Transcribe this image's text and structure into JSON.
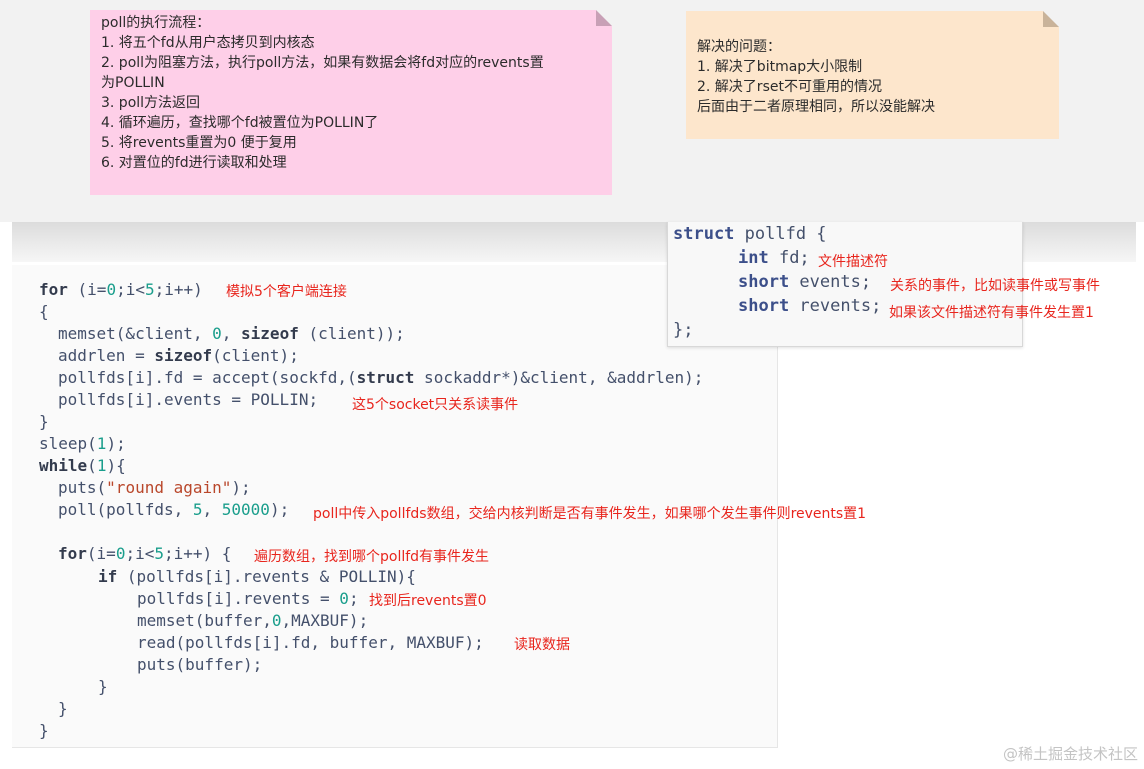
{
  "note_left": {
    "lines": [
      "poll的执行流程：",
      "1. 将五个fd从用户态拷贝到内核态",
      "2. poll为阻塞方法，执行poll方法，如果有数据会将fd对应的revents置",
      "为POLLIN",
      "3. poll方法返回",
      "4. 循环遍历，查找哪个fd被置位为POLLIN了",
      "5. 将revents重置为0 便于复用",
      "6. 对置位的fd进行读取和处理"
    ]
  },
  "note_right": {
    "lines": [
      "解决的问题：",
      "1. 解决了bitmap大小限制",
      "2. 解决了rset不可重用的情况",
      "后面由于二者原理相同，所以没能解决"
    ]
  },
  "struct_code": {
    "l1": {
      "kw": "struct",
      "rest": " pollfd {"
    },
    "l2": {
      "kw": "int",
      "rest": " fd;"
    },
    "l3": {
      "kw": "short",
      "rest": " events;"
    },
    "l4": {
      "kw": "short",
      "rest": " revents;"
    },
    "l5": "};"
  },
  "struct_annotations": {
    "fd": "文件描述符",
    "events": "关系的事件，比如读事件或写事件",
    "revents": "如果该文件描述符有事件发生置1"
  },
  "code": {
    "l1": {
      "kw": "for",
      "a": " (i=",
      "n1": "0",
      "b": ";i<",
      "n2": "5",
      "c": ";i++)"
    },
    "l2": "{",
    "l3": {
      "a": "memset(&client, ",
      "n1": "0",
      "b": ", ",
      "kw": "sizeof",
      "c": " (client));"
    },
    "l4": {
      "a": "addrlen = ",
      "kw": "sizeof",
      "b": "(client);"
    },
    "l5": {
      "a": "pollfds[i].fd = accept(sockfd,(",
      "kw": "struct",
      "b": " sockaddr*)&client, &addrlen);"
    },
    "l6": "pollfds[i].events = POLLIN;",
    "l7": "}",
    "l8": {
      "a": "sleep(",
      "n1": "1",
      "b": ");"
    },
    "l9": {
      "kw": "while",
      "a": "(",
      "n1": "1",
      "b": "){"
    },
    "l10": {
      "a": "puts(",
      "s": "\"round again\"",
      "b": ");"
    },
    "l11": {
      "a": "poll(pollfds, ",
      "n1": "5",
      "b": ", ",
      "n2": "50000",
      "c": ");"
    },
    "l12": {
      "kw": "for",
      "a": "(i=",
      "n1": "0",
      "b": ";i<",
      "n2": "5",
      "c": ";i++) {"
    },
    "l13": {
      "kw": "if",
      "a": " (pollfds[i].revents & POLLIN){"
    },
    "l14": {
      "a": "pollfds[i].revents = ",
      "n1": "0",
      "b": ";"
    },
    "l15": {
      "a": "memset(buffer,",
      "n1": "0",
      "b": ",MAXBUF);"
    },
    "l16": "read(pollfds[i].fd, buffer, MAXBUF);",
    "l17": "puts(buffer);",
    "l18": "}",
    "l19": "}",
    "l20": "}"
  },
  "annotations": {
    "clients": "模拟5个客户端连接",
    "read_event": "这5个socket只关系读事件",
    "poll_call": "poll中传入pollfds数组，交给内核判断是否有事件发生，如果哪个发生事件则revents置1",
    "loop": "遍历数组，找到哪个pollfd有事件发生",
    "reset": "找到后revents置0",
    "read": "读取数据"
  },
  "watermark": "@稀土掘金技术社区",
  "colors": {
    "note_pink": "#fecfe8",
    "note_orange": "#fde6cc",
    "annotation_red": "#e8251d",
    "code_text": "#44506b",
    "number_teal": "#1a9e8c"
  }
}
